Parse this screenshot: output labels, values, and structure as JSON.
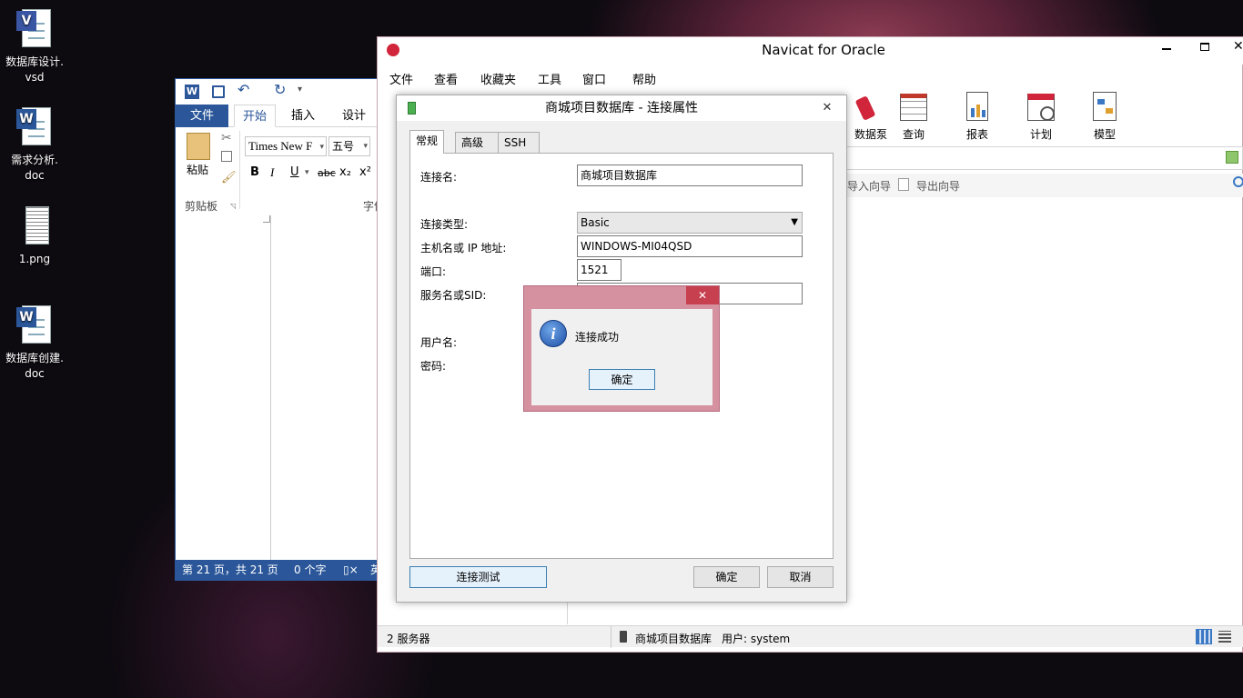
{
  "desktop": {
    "icons": [
      {
        "label": "数据库设计.\nvsd",
        "icon": "visio-file-icon"
      },
      {
        "label": "需求分析.\ndoc",
        "icon": "word-file-icon"
      },
      {
        "label": "1.png",
        "icon": "image-file-icon"
      },
      {
        "label": "数据库创建.\ndoc",
        "icon": "word-file-icon"
      }
    ]
  },
  "word": {
    "tabs": [
      "文件",
      "开始",
      "插入",
      "设计"
    ],
    "font_name": "Times New F",
    "font_size": "五号",
    "paste_label": "粘贴",
    "clipboard_label": "剪贴板",
    "font_group_label": "字体",
    "format_buttons": [
      "B",
      "I",
      "U",
      "abc",
      "x₂",
      "x²"
    ],
    "status": {
      "page": "第 21 页，共 21 页",
      "words": "0 个字",
      "lang": "英"
    }
  },
  "navicat": {
    "title": "Navicat for Oracle",
    "menu": [
      "文件",
      "查看",
      "收藏夹",
      "工具",
      "窗口",
      "帮助"
    ],
    "toolbar": [
      {
        "label": "数据泵",
        "icon": "data-pump-icon"
      },
      {
        "label": "查询",
        "icon": "query-icon"
      },
      {
        "label": "报表",
        "icon": "report-icon"
      },
      {
        "label": "计划",
        "icon": "schedule-icon"
      },
      {
        "label": "模型",
        "icon": "model-icon"
      }
    ],
    "subtools": [
      "导入向导",
      "导出向导"
    ],
    "status": {
      "servers": "2 服务器",
      "connection": "商城项目数据库",
      "user": "用户: system"
    }
  },
  "conn_dialog": {
    "title": "商城项目数据库 - 连接属性",
    "tabs": [
      "常规",
      "高级",
      "SSH"
    ],
    "fields": {
      "conn_name_label": "连接名:",
      "conn_name": "商城项目数据库",
      "conn_type_label": "连接类型:",
      "conn_type": "Basic",
      "host_label": "主机名或 IP 地址:",
      "host": "WINDOWS-MI04QSD",
      "port_label": "端口:",
      "port": "1521",
      "service_label": "服务名或SID:",
      "service": "",
      "user_label": "用户名:",
      "password_label": "密码:"
    },
    "test_button": "连接测试",
    "ok_button": "确定",
    "cancel_button": "取消"
  },
  "message_box": {
    "text": "连接成功",
    "ok_button": "确定",
    "close": "✕"
  }
}
